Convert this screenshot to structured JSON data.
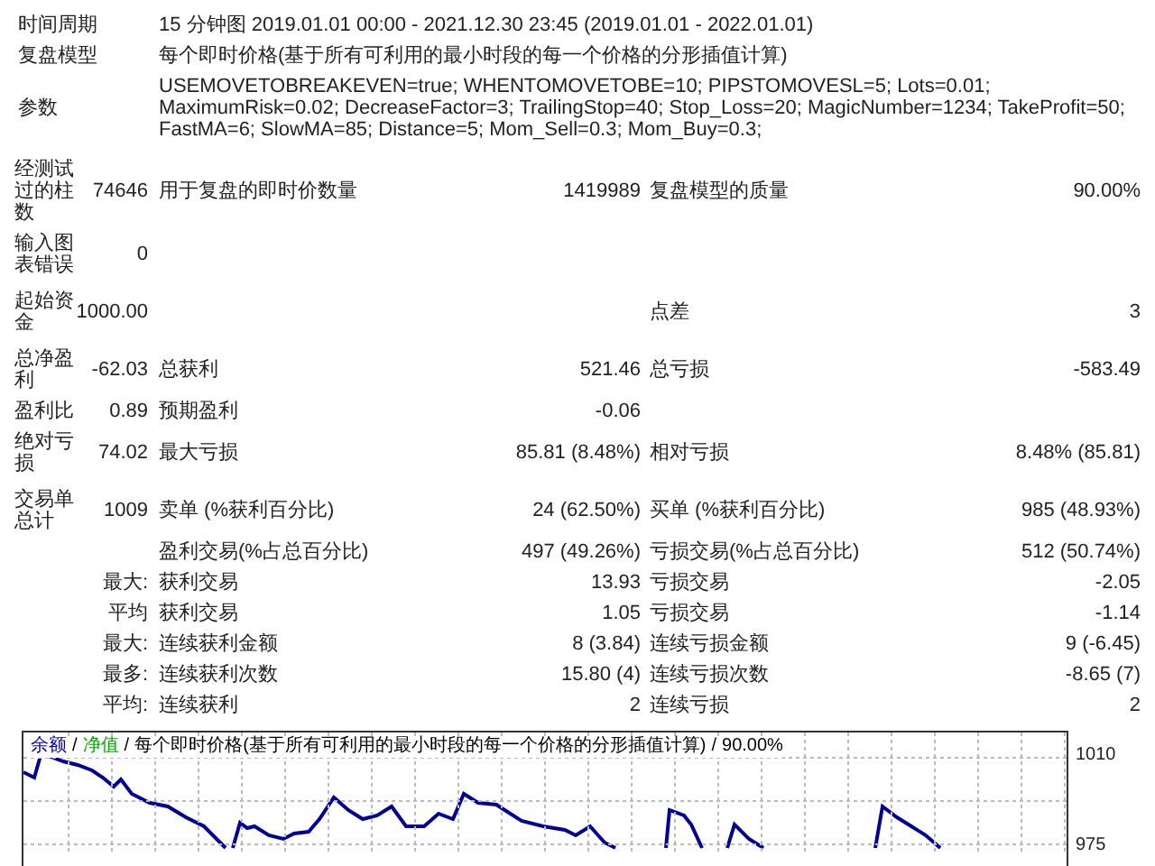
{
  "info": [
    {
      "label": "时间周期",
      "value": "15 分钟图 2019.01.01 00:00 - 2021.12.30 23:45 (2019.01.01 - 2022.01.01)"
    },
    {
      "label": "复盘模型",
      "value": "每个即时价格(基于所有可利用的最小时段的每一个价格的分形插值计算)"
    },
    {
      "label": "参数",
      "value": "USEMOVETOBREAKEVEN=true; WHENTOMOVETOBE=10; PIPSTOMOVESL=5; Lots=0.01; MaximumRisk=0.02; DecreaseFactor=3; TrailingStop=40; Stop_Loss=20; MagicNumber=1234; TakeProfit=50; FastMA=6; SlowMA=85; Distance=5; Mom_Sell=0.3; Mom_Buy=0.3;"
    }
  ],
  "stat_groups": [
    [
      {
        "label": "经测试过的柱数",
        "value": "74646",
        "label2": "用于复盘的即时价数量",
        "value2": "1419989",
        "label3": "复盘模型的质量",
        "value3": "90.00%"
      },
      {
        "label": "输入图表错误",
        "value": "0"
      }
    ],
    [
      {
        "label": "起始资金",
        "value": "1000.00",
        "label3": "点差",
        "value3": "3"
      }
    ],
    [
      {
        "label": "总净盈利",
        "value": "-62.03",
        "label2": "总获利",
        "value2": "521.46",
        "label3": "总亏损",
        "value3": "-583.49"
      },
      {
        "label": "盈利比",
        "value": "0.89",
        "label2": "预期盈利",
        "value2": "-0.06"
      },
      {
        "label": "绝对亏损",
        "value": "74.02",
        "label2": "最大亏损",
        "value2": "85.81 (8.48%)",
        "label3": "相对亏损",
        "value3": "8.48% (85.81)"
      }
    ],
    [
      {
        "label": "交易单总计",
        "value": "1009",
        "label2": "卖单 (%获利百分比)",
        "value2": "24 (62.50%)",
        "label3": "买单 (%获利百分比)",
        "value3": "985 (48.93%)"
      },
      {
        "label2": "盈利交易(%占总百分比)",
        "value2": "497 (49.26%)",
        "label3": "亏损交易(%占总百分比)",
        "value3": "512 (50.74%)"
      },
      {
        "value": "最大:",
        "label2": "获利交易",
        "value2": "13.93",
        "label3": "亏损交易",
        "value3": "-2.05"
      },
      {
        "value": "平均",
        "label2": "获利交易",
        "value2": "1.05",
        "label3": "亏损交易",
        "value3": "-1.14"
      },
      {
        "value": "最大:",
        "label2": "连续获利金额",
        "value2": "8 (3.84)",
        "label3": "连续亏损金额",
        "value3": "9 (-6.45)"
      },
      {
        "value": "最多:",
        "label2": "连续获利次数",
        "value2": "15.80 (4)",
        "label3": "连续亏损次数",
        "value3": "-8.65 (7)"
      },
      {
        "value": "平均:",
        "label2": "连续获利",
        "value2": "2",
        "label3": "连续亏损",
        "value3": "2"
      }
    ]
  ],
  "chart": {
    "legend": [
      {
        "text": "余额",
        "color": "#0000aa"
      },
      {
        "text": "/",
        "color": "#000000"
      },
      {
        "text": "净值",
        "color": "#00aa00"
      },
      {
        "text": "/",
        "color": "#000000"
      },
      {
        "text": "每个即时价格(基于所有可利用的最小时段的每一个价格的分形插值计算)",
        "color": "#000000"
      },
      {
        "text": "/",
        "color": "#000000"
      },
      {
        "text": "90.00%",
        "color": "#000000"
      }
    ],
    "axis_labels": [
      "1010",
      "975"
    ]
  }
}
